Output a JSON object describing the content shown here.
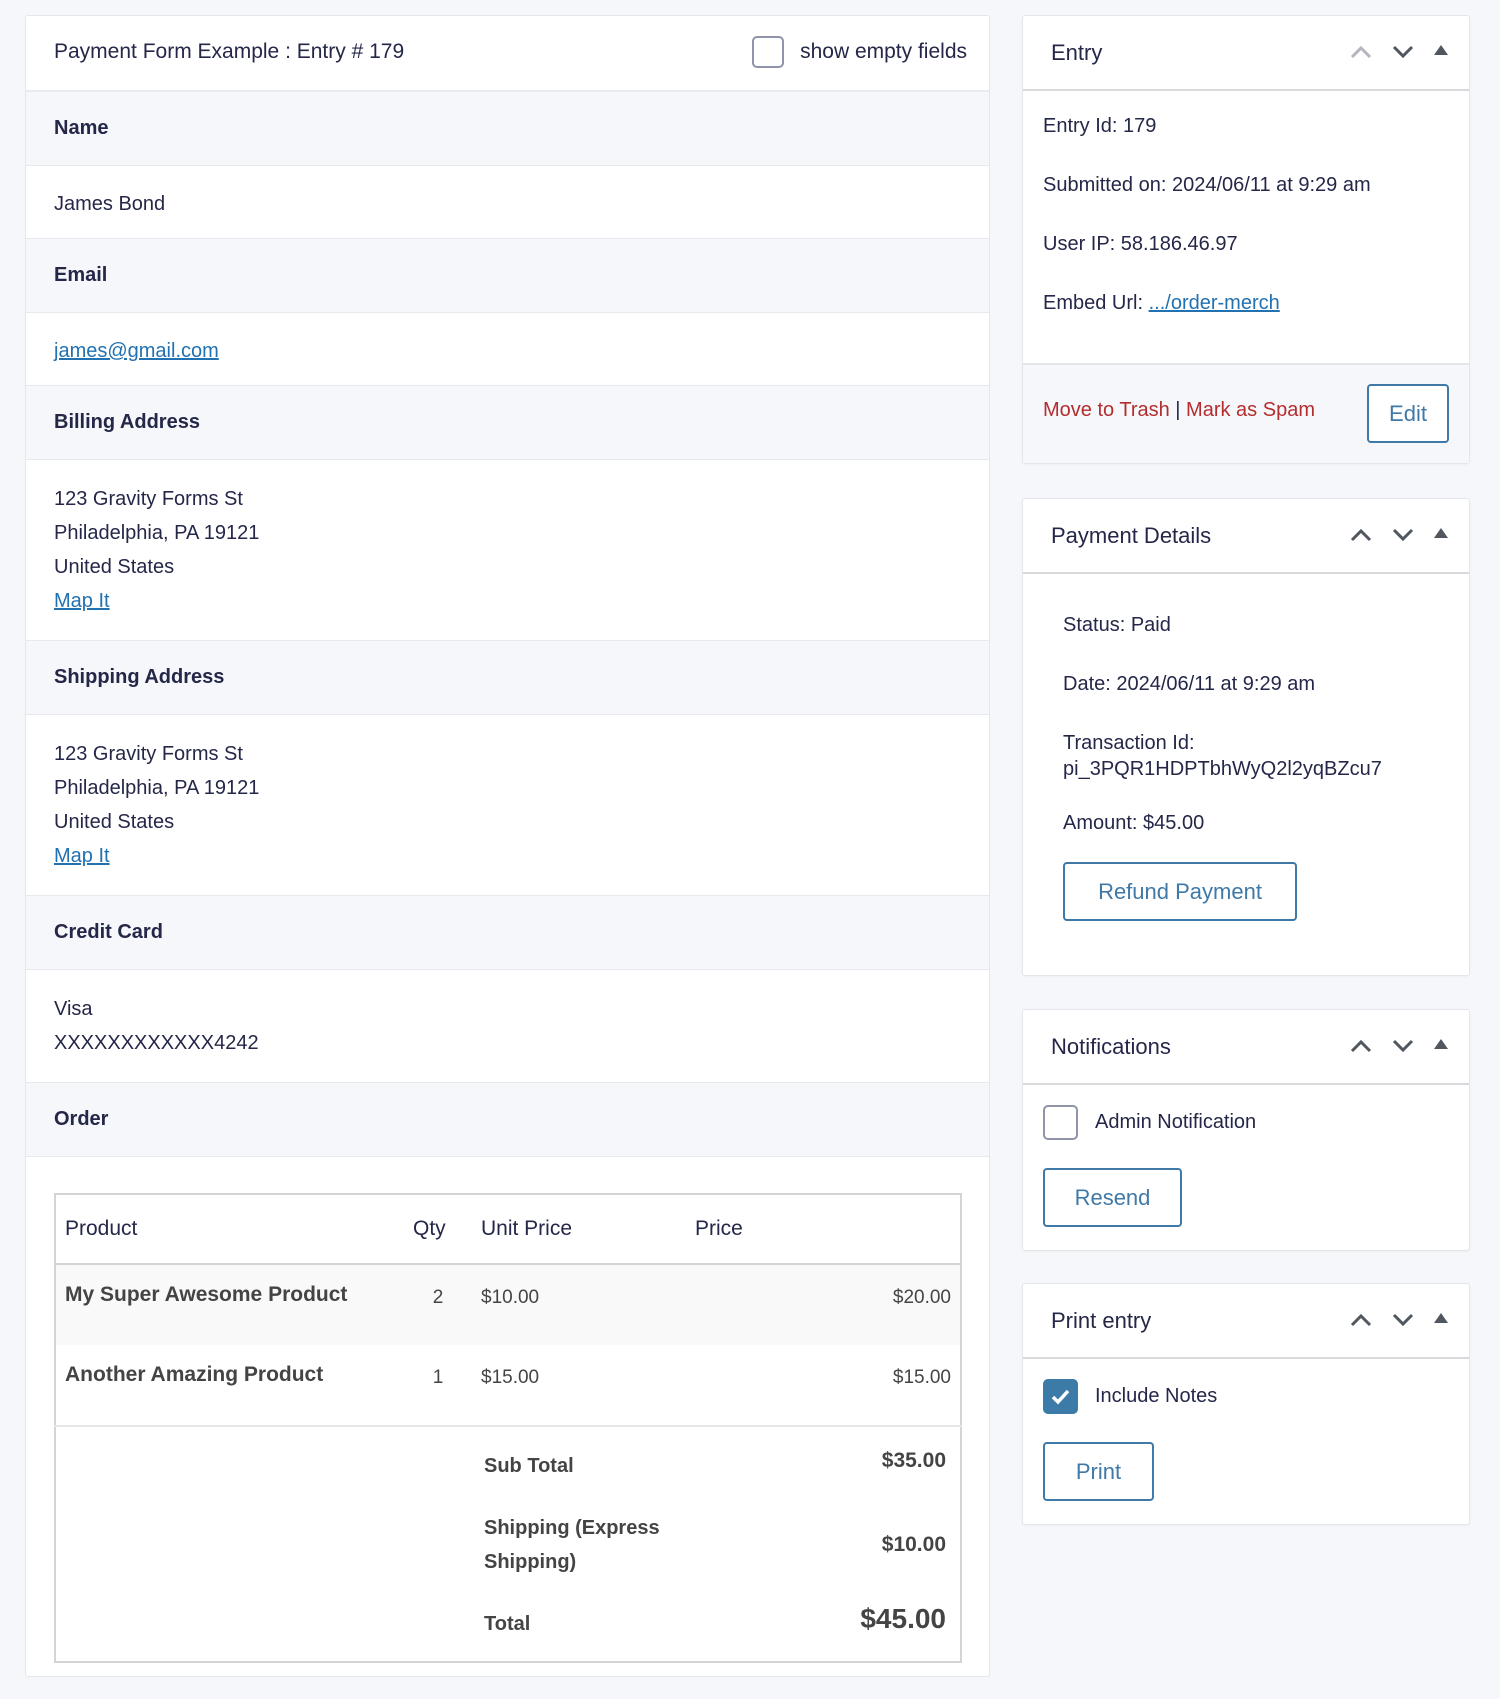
{
  "main": {
    "title": "Payment Form Example : Entry # 179",
    "show_empty_label": "show empty fields",
    "show_empty_checked": false,
    "fields": {
      "name": {
        "label": "Name",
        "value": "James Bond"
      },
      "email": {
        "label": "Email",
        "value": "james@gmail.com"
      },
      "billing": {
        "label": "Billing Address",
        "lines": [
          "123 Gravity Forms St",
          "Philadelphia, PA 19121",
          "United States"
        ],
        "map_link": "Map It"
      },
      "shipping": {
        "label": "Shipping Address",
        "lines": [
          "123 Gravity Forms St",
          "Philadelphia, PA 19121",
          "United States"
        ],
        "map_link": "Map It"
      },
      "credit_card": {
        "label": "Credit Card",
        "type": "Visa",
        "number": "XXXXXXXXXXXX4242"
      },
      "order": {
        "label": "Order"
      }
    },
    "order": {
      "headers": {
        "product": "Product",
        "qty": "Qty",
        "unit_price": "Unit Price",
        "price": "Price"
      },
      "items": [
        {
          "product": "My Super Awesome Product",
          "qty": "2",
          "unit_price": "$10.00",
          "price": "$20.00"
        },
        {
          "product": "Another Amazing Product",
          "qty": "1",
          "unit_price": "$15.00",
          "price": "$15.00"
        }
      ],
      "subtotal_label": "Sub Total",
      "subtotal": "$35.00",
      "shipping_label": "Shipping (Express Shipping)",
      "shipping": "$10.00",
      "total_label": "Total",
      "total": "$45.00",
      "total_color": "#2e7d52"
    }
  },
  "entry_box": {
    "title": "Entry",
    "entry_id": "Entry Id: 179",
    "submitted": "Submitted on: 2024/06/11 at 9:29 am",
    "user_ip": "User IP: 58.186.46.97",
    "embed_label": "Embed Url: ",
    "embed_link": ".../order-merch",
    "trash": "Move to Trash",
    "separator": "|",
    "spam": "Mark as Spam",
    "edit": "Edit"
  },
  "payment_box": {
    "title": "Payment Details",
    "status": "Status: Paid",
    "date": "Date: 2024/06/11 at 9:29 am",
    "transaction_label": "Transaction Id:",
    "transaction_id": "pi_3PQR1HDPTbhWyQ2l2yqBZcu7",
    "amount": "Amount: $45.00",
    "refund": "Refund Payment"
  },
  "notifications_box": {
    "title": "Notifications",
    "admin_label": "Admin Notification",
    "admin_checked": false,
    "resend": "Resend"
  },
  "print_box": {
    "title": "Print entry",
    "notes_label": "Include Notes",
    "notes_checked": true,
    "print": "Print"
  },
  "colors": {
    "accent": "#3f79a8",
    "link": "#2271b1",
    "danger": "#b32d2e",
    "total": "#2e7d52"
  },
  "icons": {
    "move_up": "chevron-up-icon",
    "move_down": "chevron-down-icon",
    "toggle": "triangle-up-icon",
    "check": "checkmark-icon"
  }
}
